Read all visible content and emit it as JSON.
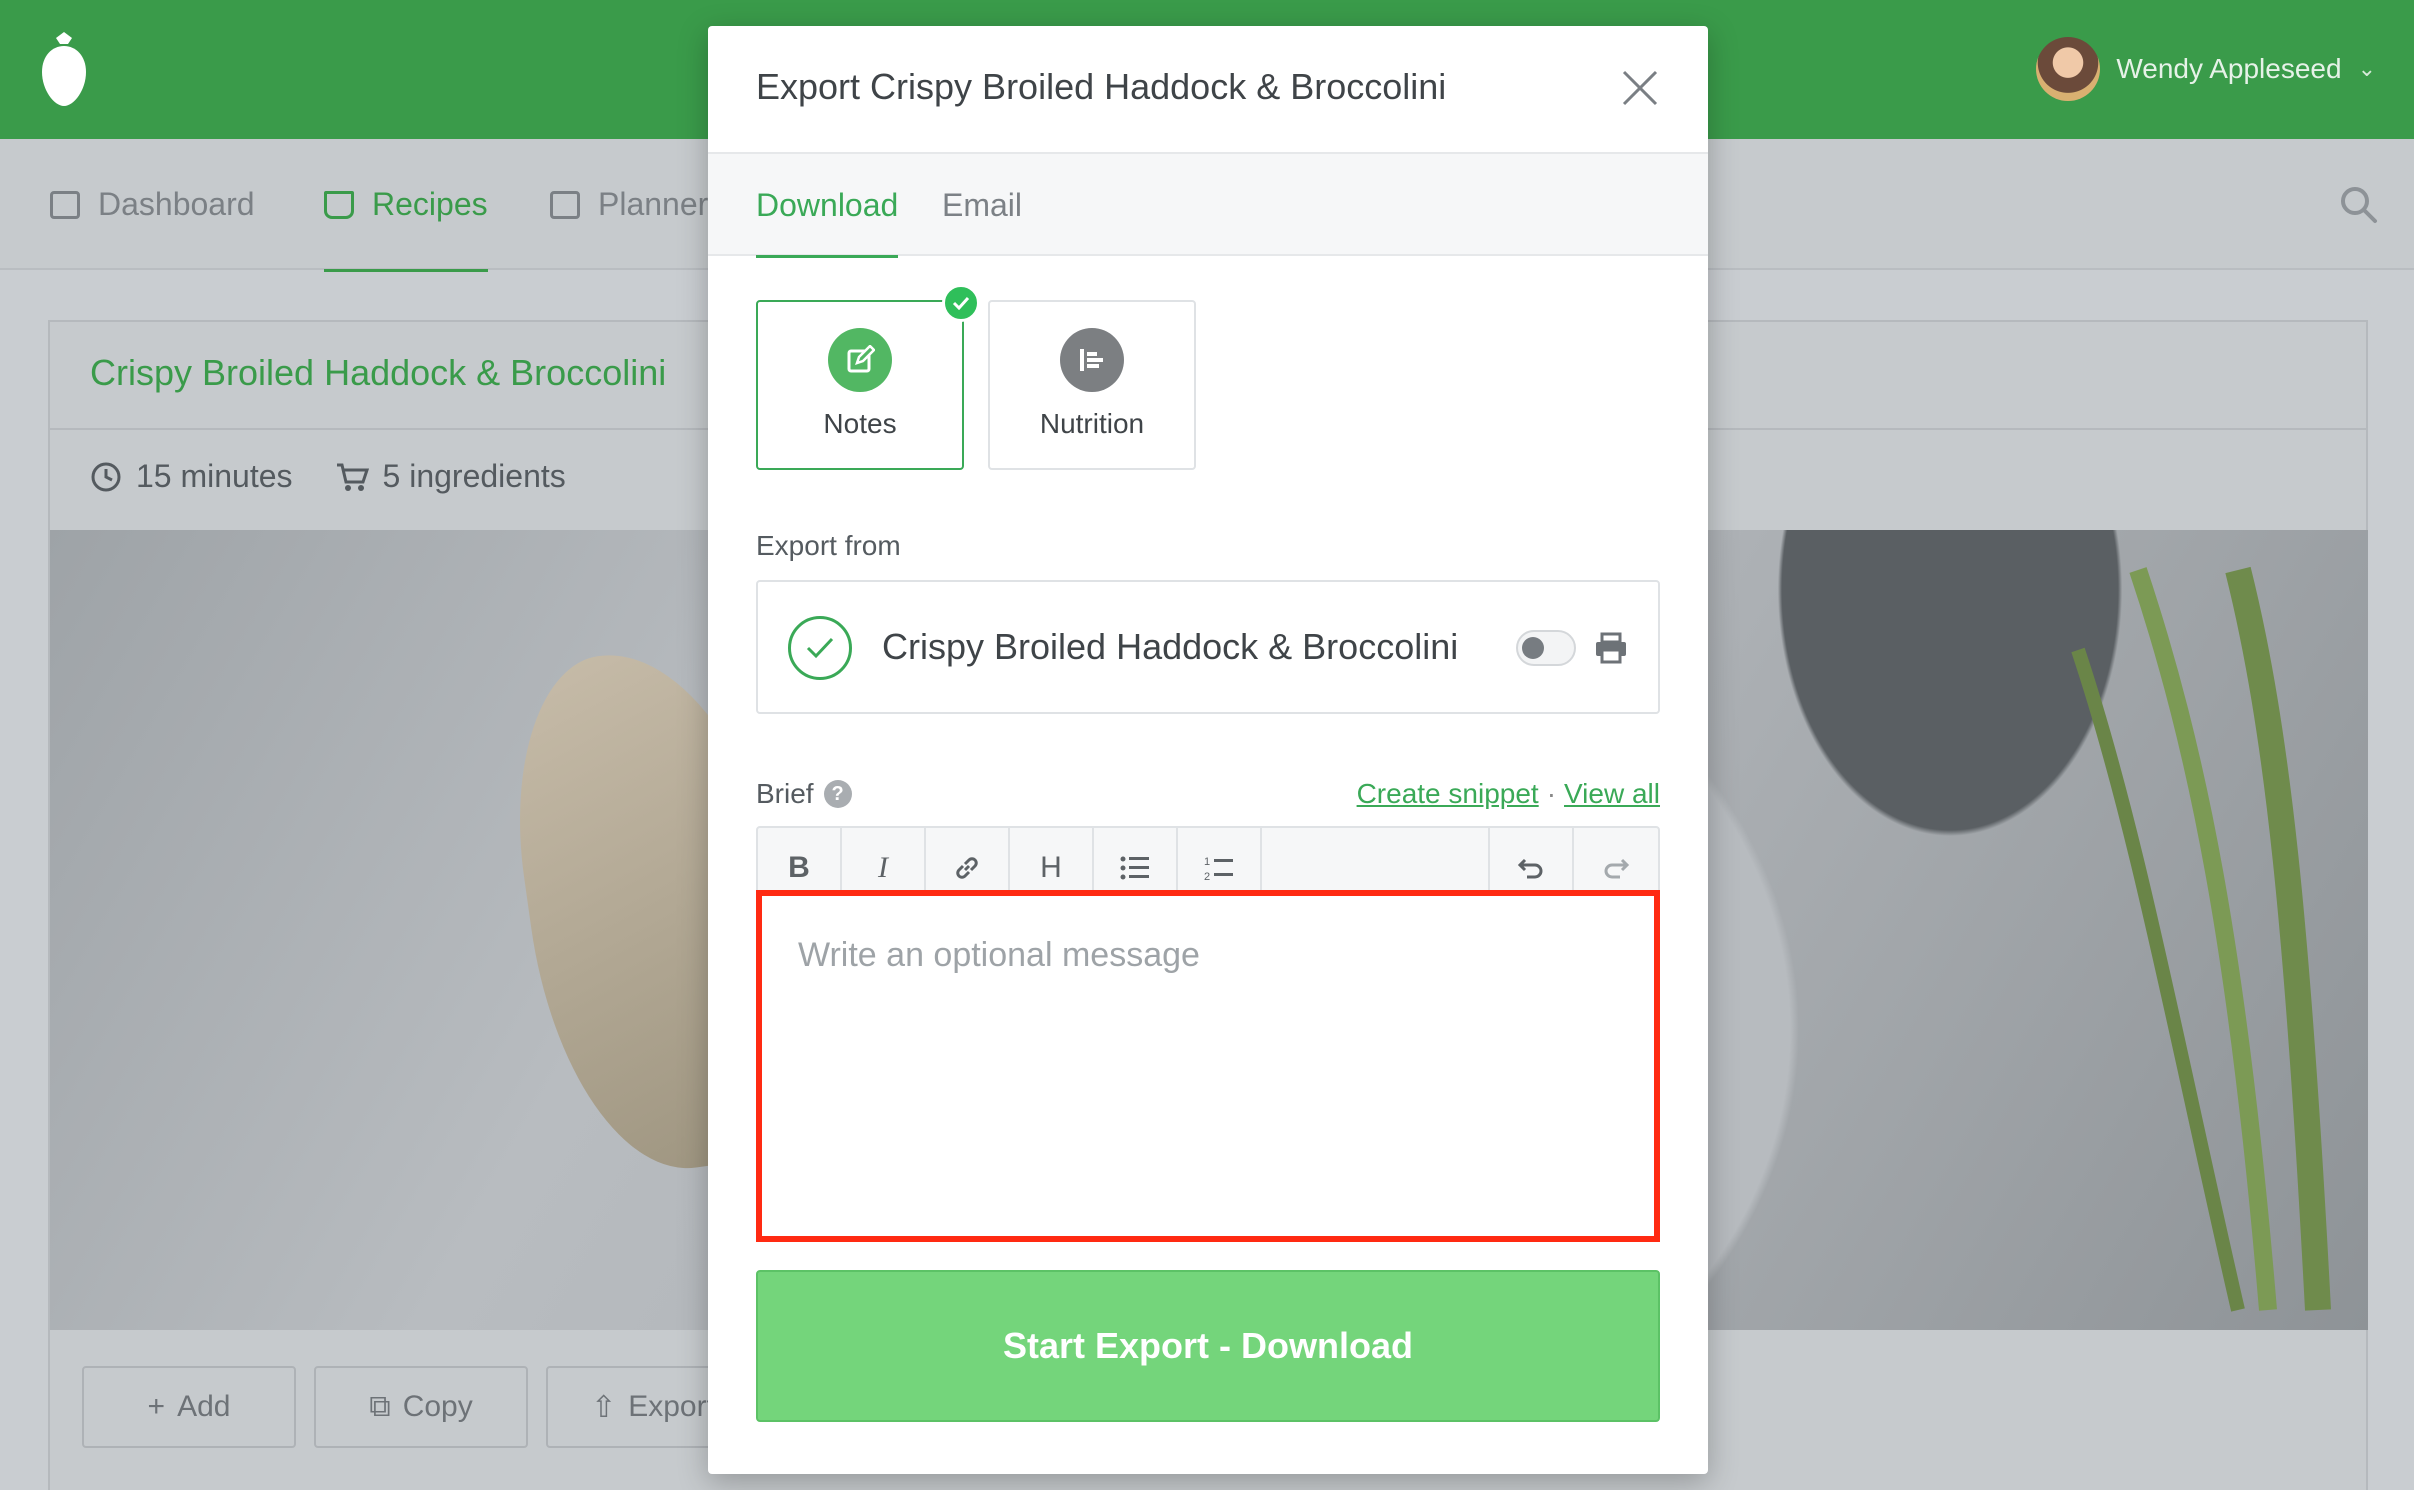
{
  "app": {
    "user_name": "Wendy Appleseed",
    "user_menu_icon": "chevron-down-icon"
  },
  "nav": {
    "items": [
      {
        "label": "Dashboard",
        "icon": "dashboard-icon"
      },
      {
        "label": "Recipes",
        "icon": "tray-icon",
        "active": true
      },
      {
        "label": "Planner",
        "icon": "calendar-icon"
      }
    ],
    "search_icon": "search-icon"
  },
  "recipe": {
    "title": "Crispy Broiled Haddock & Broccolini",
    "time": "15 minutes",
    "ingredients": "5 ingredients",
    "actions": [
      {
        "label": "Add",
        "icon": "plus-icon"
      },
      {
        "label": "Copy",
        "icon": "copy-icon"
      },
      {
        "label": "Export",
        "icon": "upload-icon"
      }
    ]
  },
  "modal": {
    "title": "Export Crispy Broiled Haddock & Broccolini",
    "tabs": [
      {
        "label": "Download",
        "active": true
      },
      {
        "label": "Email",
        "active": false
      }
    ],
    "options": [
      {
        "label": "Notes",
        "selected": true,
        "icon": "edit-icon",
        "color": "#52b763"
      },
      {
        "label": "Nutrition",
        "selected": false,
        "icon": "chart-icon",
        "color": "#7c7f82"
      }
    ],
    "export_from_label": "Export from",
    "export_from_item": "Crispy Broiled Haddock & Broccolini",
    "brief_label": "Brief",
    "brief_help": "?",
    "create_snippet": "Create snippet",
    "separator": "·",
    "view_all": "View all",
    "toolbar": [
      "B",
      "I",
      "link",
      "H",
      "bulleted-list",
      "numbered-list",
      "undo",
      "redo"
    ],
    "message_placeholder": "Write an optional message",
    "submit_label": "Start Export - Download"
  },
  "colors": {
    "brand_green": "#3a9b4a",
    "accent_green": "#3aa957",
    "button_green": "#74d57b",
    "highlight_red": "#ff2a12"
  }
}
